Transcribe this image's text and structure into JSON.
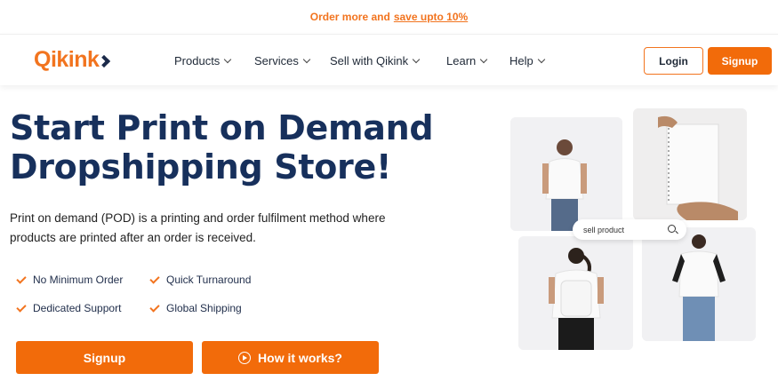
{
  "announcement": {
    "text": "Order more and",
    "link": "save upto 10%"
  },
  "header": {
    "logo": "Qikink",
    "menu": [
      {
        "label": "Products"
      },
      {
        "label": "Services"
      },
      {
        "label": "Sell with Qikink"
      },
      {
        "label": "Learn"
      },
      {
        "label": "Help"
      }
    ],
    "login_label": "Login",
    "signup_label": "Signup"
  },
  "hero": {
    "title_line1": "Start Print on Demand",
    "title_line2": "Dropshipping Store!",
    "description": "Print on demand (POD) is a printing and order fulfilment method where products are printed after an order is received.",
    "features": [
      "No Minimum Order",
      "Quick Turnaround",
      "Dedicated Support",
      "Global Shipping"
    ],
    "signup_cta": "Signup",
    "how_cta": "How it works?"
  },
  "gallery": {
    "search_text": "sell product"
  },
  "colors": {
    "brand_orange": "#f26b0a",
    "heading_navy": "#17305c"
  }
}
